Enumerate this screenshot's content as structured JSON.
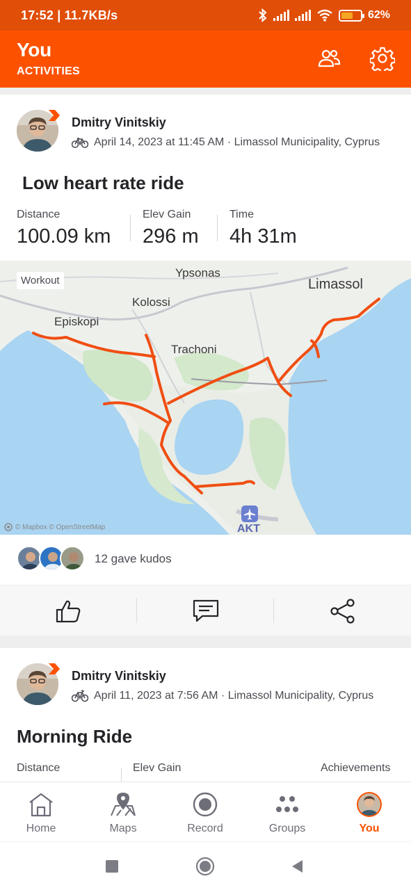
{
  "status_bar": {
    "time": "17:52 | 11.7KB/s",
    "battery": "62%",
    "battery_level": 0.62
  },
  "header": {
    "title": "You",
    "subtitle": "ACTIVITIES",
    "icons": [
      "people-icon",
      "gear-icon"
    ]
  },
  "activities": [
    {
      "athlete": "Dmitry Vinitskiy",
      "meta": "April 14, 2023 at 11:45 AM · Limassol Municipality, Cyprus",
      "sport_icon": "bike-icon",
      "title": "Low heart rate ride",
      "stats": [
        {
          "label": "Distance",
          "value": "100.09 km"
        },
        {
          "label": "Elev Gain",
          "value": "296 m"
        },
        {
          "label": "Time",
          "value": "4h 31m"
        }
      ],
      "map": {
        "tag": "Workout",
        "credit": "© Mapbox © OpenStreetMap",
        "places": [
          "Ypsonas",
          "Limassol",
          "Kolossi",
          "Episkopi",
          "Trachoni",
          "AKT"
        ]
      },
      "kudos_text": "12 gave kudos"
    },
    {
      "athlete": "Dmitry Vinitskiy",
      "meta": "April 11, 2023 at 7:56 AM · Limassol Municipality, Cyprus",
      "sport_icon": "bike-icon",
      "title": "Morning Ride",
      "stats": [
        {
          "label": "Distance"
        },
        {
          "label": "Elev Gain"
        },
        {
          "label": "Achievements"
        }
      ]
    }
  ],
  "bottom_nav": [
    {
      "label": "Home",
      "icon": "home-icon"
    },
    {
      "label": "Maps",
      "icon": "maps-icon"
    },
    {
      "label": "Record",
      "icon": "record-icon"
    },
    {
      "label": "Groups",
      "icon": "groups-icon"
    },
    {
      "label": "You",
      "icon": "avatar",
      "active": true
    }
  ],
  "colors": {
    "brand": "#fc5200",
    "status_bar": "#e04e08",
    "route": "#f04e12"
  }
}
